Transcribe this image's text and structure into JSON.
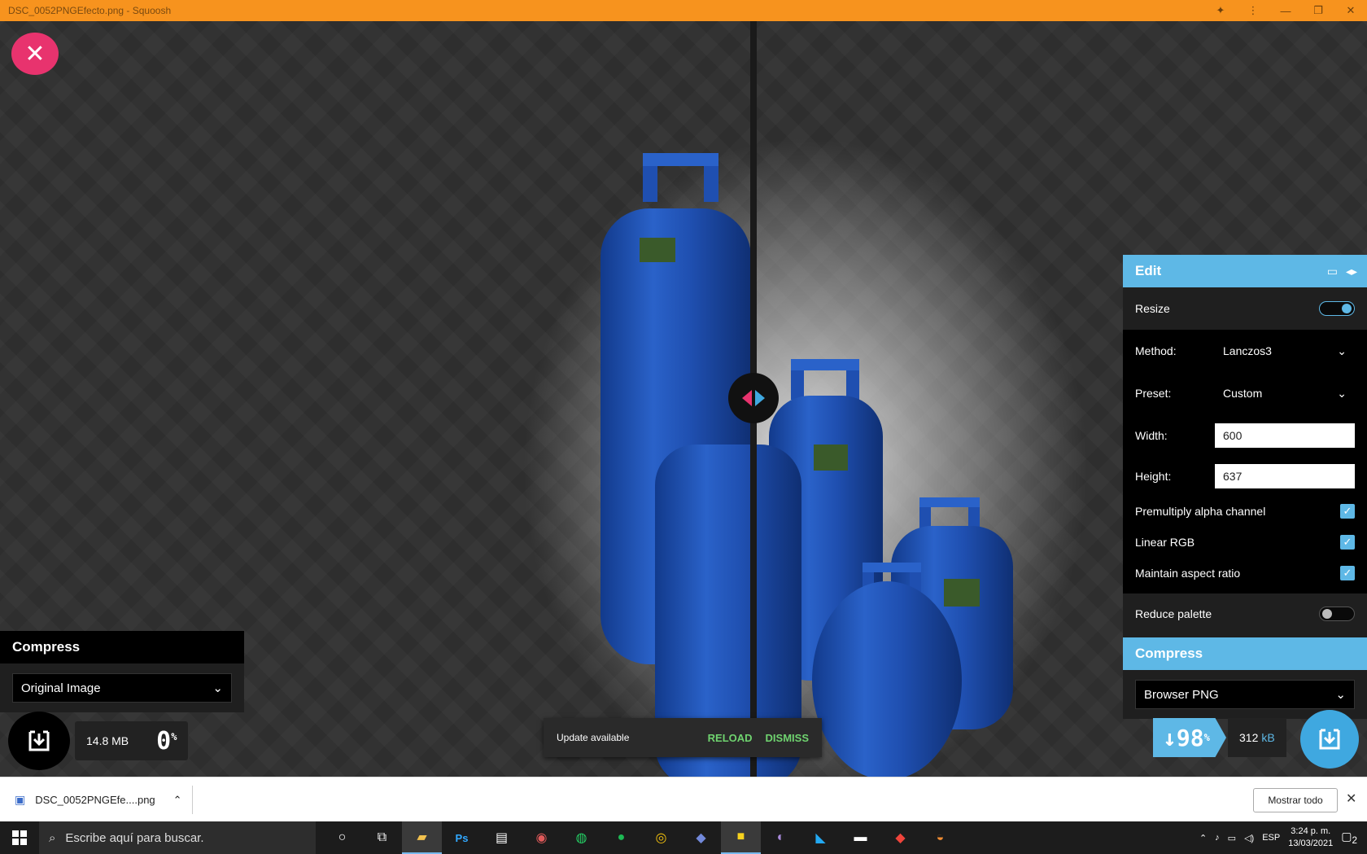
{
  "window": {
    "title": "DSC_0052PNGEfecto.png - Squoosh"
  },
  "left": {
    "section_title": "Compress",
    "method": "Original Image",
    "size": "14.8 MB",
    "percent": "0",
    "percent_sign": "%"
  },
  "edit": {
    "title": "Edit",
    "resize_label": "Resize",
    "method_label": "Method:",
    "method_value": "Lanczos3",
    "preset_label": "Preset:",
    "preset_value": "Custom",
    "width_label": "Width:",
    "width_value": "600",
    "height_label": "Height:",
    "height_value": "637",
    "premultiply_label": "Premultiply alpha channel",
    "linear_rgb_label": "Linear RGB",
    "aspect_label": "Maintain aspect ratio",
    "reduce_palette_label": "Reduce palette",
    "resize_on": true,
    "premultiply_checked": true,
    "linear_rgb_checked": true,
    "aspect_checked": true,
    "reduce_palette_on": false
  },
  "right": {
    "section_title": "Compress",
    "method": "Browser PNG",
    "arrow": "↓",
    "percent": "98",
    "percent_sign": "%",
    "size": "312",
    "size_unit": "kB"
  },
  "toast": {
    "message": "Update available",
    "reload": "RELOAD",
    "dismiss": "DISMISS"
  },
  "downloads": {
    "file": "DSC_0052PNGEfe....png",
    "show_all": "Mostrar todo"
  },
  "taskbar": {
    "search_placeholder": "Escribe aquí para buscar.",
    "language": "ESP",
    "time": "3:24 p. m.",
    "date": "13/03/2021",
    "notifications": "2"
  },
  "colors": {
    "titlebar": "#f7931e",
    "accent_blue": "#5eb8e6",
    "accent_pink": "#e8336e",
    "toast_action": "#6fd36f"
  }
}
